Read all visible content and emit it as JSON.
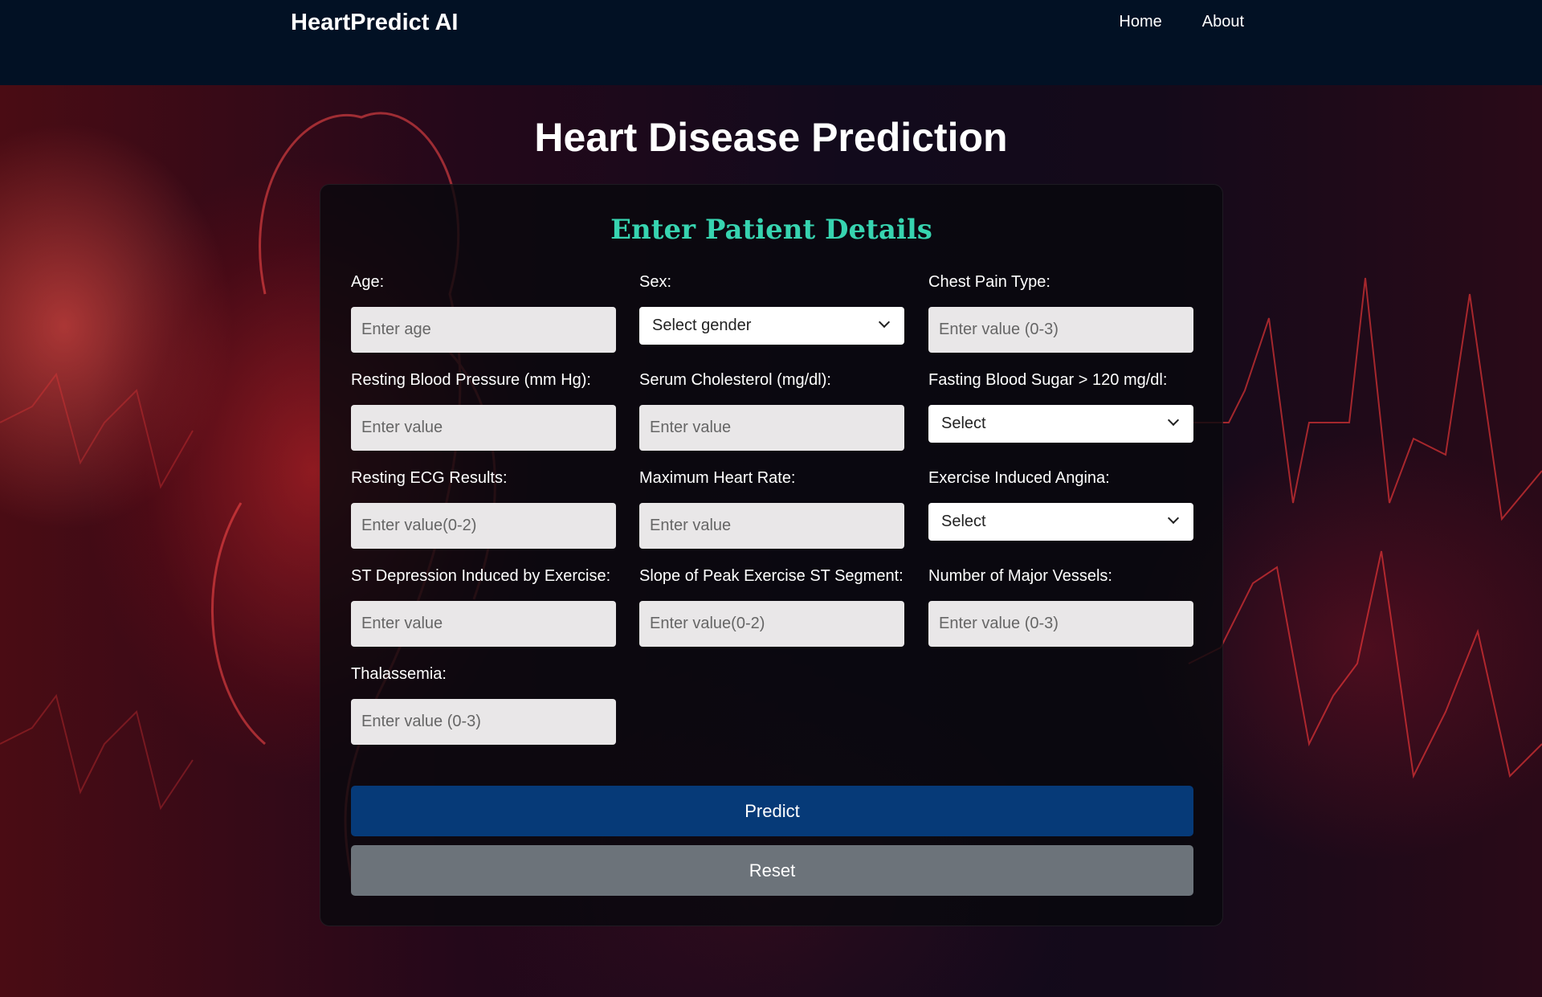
{
  "app": {
    "brand": "HeartPredict AI"
  },
  "nav": {
    "items": [
      "Home",
      "About"
    ]
  },
  "page": {
    "title": "Heart Disease Prediction"
  },
  "form": {
    "title": "Enter Patient Details",
    "fields": [
      {
        "label": "Age:",
        "type": "input",
        "placeholder": "Enter age"
      },
      {
        "label": "Sex:",
        "type": "select",
        "value": "Select gender"
      },
      {
        "label": "Chest Pain Type:",
        "type": "input",
        "placeholder": "Enter value (0-3)"
      },
      {
        "label": "Resting Blood Pressure (mm Hg):",
        "type": "input",
        "placeholder": "Enter value"
      },
      {
        "label": "Serum Cholesterol (mg/dl):",
        "type": "input",
        "placeholder": "Enter value"
      },
      {
        "label": "Fasting Blood Sugar > 120 mg/dl:",
        "type": "select",
        "value": "Select"
      },
      {
        "label": "Resting ECG Results:",
        "type": "input",
        "placeholder": "Enter value(0-2)"
      },
      {
        "label": "Maximum Heart Rate:",
        "type": "input",
        "placeholder": "Enter value"
      },
      {
        "label": "Exercise Induced Angina:",
        "type": "select",
        "value": "Select"
      },
      {
        "label": "ST Depression Induced by Exercise:",
        "type": "input",
        "placeholder": "Enter value"
      },
      {
        "label": "Slope of Peak Exercise ST Segment:",
        "type": "input",
        "placeholder": "Enter value(0-2)"
      },
      {
        "label": "Number of Major Vessels:",
        "type": "input",
        "placeholder": "Enter value (0-3)"
      },
      {
        "label": "Thalassemia:",
        "type": "input",
        "placeholder": "Enter value (0-3)"
      }
    ],
    "buttons": {
      "predict": "Predict",
      "reset": "Reset"
    }
  },
  "colors": {
    "navbar": "#021124",
    "accent_title": "#37d4b0",
    "predict_button": "#063a78",
    "reset_button": "#6c737a"
  }
}
